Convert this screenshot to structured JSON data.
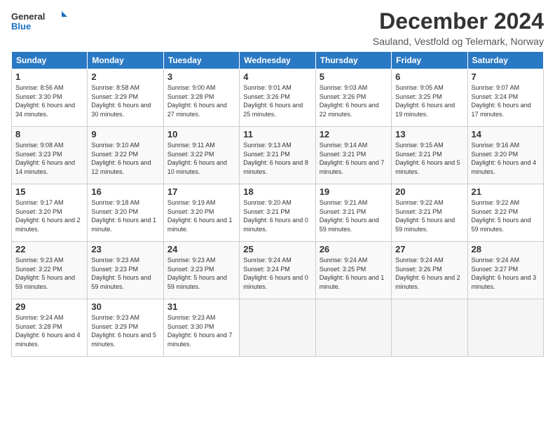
{
  "header": {
    "logo_line1": "General",
    "logo_line2": "Blue",
    "title": "December 2024",
    "subtitle": "Sauland, Vestfold og Telemark, Norway"
  },
  "weekdays": [
    "Sunday",
    "Monday",
    "Tuesday",
    "Wednesday",
    "Thursday",
    "Friday",
    "Saturday"
  ],
  "weeks": [
    [
      {
        "day": "1",
        "info": "Sunrise: 8:56 AM\nSunset: 3:30 PM\nDaylight: 6 hours and 34 minutes."
      },
      {
        "day": "2",
        "info": "Sunrise: 8:58 AM\nSunset: 3:29 PM\nDaylight: 6 hours and 30 minutes."
      },
      {
        "day": "3",
        "info": "Sunrise: 9:00 AM\nSunset: 3:28 PM\nDaylight: 6 hours and 27 minutes."
      },
      {
        "day": "4",
        "info": "Sunrise: 9:01 AM\nSunset: 3:26 PM\nDaylight: 6 hours and 25 minutes."
      },
      {
        "day": "5",
        "info": "Sunrise: 9:03 AM\nSunset: 3:26 PM\nDaylight: 6 hours and 22 minutes."
      },
      {
        "day": "6",
        "info": "Sunrise: 9:05 AM\nSunset: 3:25 PM\nDaylight: 6 hours and 19 minutes."
      },
      {
        "day": "7",
        "info": "Sunrise: 9:07 AM\nSunset: 3:24 PM\nDaylight: 6 hours and 17 minutes."
      }
    ],
    [
      {
        "day": "8",
        "info": "Sunrise: 9:08 AM\nSunset: 3:23 PM\nDaylight: 6 hours and 14 minutes."
      },
      {
        "day": "9",
        "info": "Sunrise: 9:10 AM\nSunset: 3:22 PM\nDaylight: 6 hours and 12 minutes."
      },
      {
        "day": "10",
        "info": "Sunrise: 9:11 AM\nSunset: 3:22 PM\nDaylight: 6 hours and 10 minutes."
      },
      {
        "day": "11",
        "info": "Sunrise: 9:13 AM\nSunset: 3:21 PM\nDaylight: 6 hours and 8 minutes."
      },
      {
        "day": "12",
        "info": "Sunrise: 9:14 AM\nSunset: 3:21 PM\nDaylight: 6 hours and 7 minutes."
      },
      {
        "day": "13",
        "info": "Sunrise: 9:15 AM\nSunset: 3:21 PM\nDaylight: 6 hours and 5 minutes."
      },
      {
        "day": "14",
        "info": "Sunrise: 9:16 AM\nSunset: 3:20 PM\nDaylight: 6 hours and 4 minutes."
      }
    ],
    [
      {
        "day": "15",
        "info": "Sunrise: 9:17 AM\nSunset: 3:20 PM\nDaylight: 6 hours and 2 minutes."
      },
      {
        "day": "16",
        "info": "Sunrise: 9:18 AM\nSunset: 3:20 PM\nDaylight: 6 hours and 1 minute."
      },
      {
        "day": "17",
        "info": "Sunrise: 9:19 AM\nSunset: 3:20 PM\nDaylight: 6 hours and 1 minute."
      },
      {
        "day": "18",
        "info": "Sunrise: 9:20 AM\nSunset: 3:21 PM\nDaylight: 6 hours and 0 minutes."
      },
      {
        "day": "19",
        "info": "Sunrise: 9:21 AM\nSunset: 3:21 PM\nDaylight: 5 hours and 59 minutes."
      },
      {
        "day": "20",
        "info": "Sunrise: 9:22 AM\nSunset: 3:21 PM\nDaylight: 5 hours and 59 minutes."
      },
      {
        "day": "21",
        "info": "Sunrise: 9:22 AM\nSunset: 3:22 PM\nDaylight: 5 hours and 59 minutes."
      }
    ],
    [
      {
        "day": "22",
        "info": "Sunrise: 9:23 AM\nSunset: 3:22 PM\nDaylight: 5 hours and 59 minutes."
      },
      {
        "day": "23",
        "info": "Sunrise: 9:23 AM\nSunset: 3:23 PM\nDaylight: 5 hours and 59 minutes."
      },
      {
        "day": "24",
        "info": "Sunrise: 9:23 AM\nSunset: 3:23 PM\nDaylight: 5 hours and 59 minutes."
      },
      {
        "day": "25",
        "info": "Sunrise: 9:24 AM\nSunset: 3:24 PM\nDaylight: 6 hours and 0 minutes."
      },
      {
        "day": "26",
        "info": "Sunrise: 9:24 AM\nSunset: 3:25 PM\nDaylight: 6 hours and 1 minute."
      },
      {
        "day": "27",
        "info": "Sunrise: 9:24 AM\nSunset: 3:26 PM\nDaylight: 6 hours and 2 minutes."
      },
      {
        "day": "28",
        "info": "Sunrise: 9:24 AM\nSunset: 3:27 PM\nDaylight: 6 hours and 3 minutes."
      }
    ],
    [
      {
        "day": "29",
        "info": "Sunrise: 9:24 AM\nSunset: 3:28 PM\nDaylight: 6 hours and 4 minutes."
      },
      {
        "day": "30",
        "info": "Sunrise: 9:23 AM\nSunset: 3:29 PM\nDaylight: 6 hours and 5 minutes."
      },
      {
        "day": "31",
        "info": "Sunrise: 9:23 AM\nSunset: 3:30 PM\nDaylight: 6 hours and 7 minutes."
      },
      null,
      null,
      null,
      null
    ]
  ]
}
